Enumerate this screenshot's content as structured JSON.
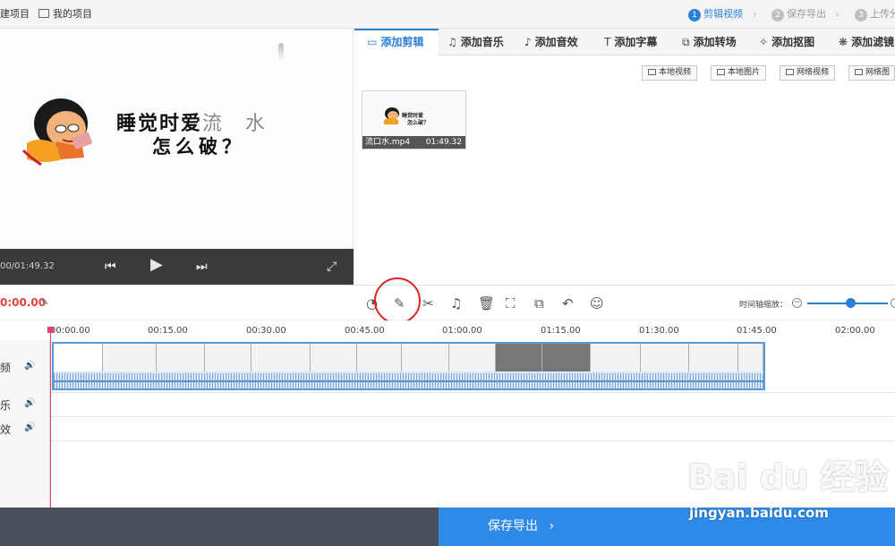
{
  "topbar": {
    "new_project": "建项目",
    "my_projects": "我的项目",
    "steps": [
      {
        "num": "1",
        "label": "剪辑视频"
      },
      {
        "num": "2",
        "label": "保存导出"
      },
      {
        "num": "3",
        "label": "上传分"
      }
    ]
  },
  "preview": {
    "title_line1_main": "睡觉时爱",
    "title_line1_faint": "流　水",
    "title_line2": "怎么破？",
    "time": "00/01:49.32"
  },
  "tabs": [
    {
      "label": "添加剪辑",
      "icon": "video-icon"
    },
    {
      "label": "添加音乐",
      "icon": "music-icon"
    },
    {
      "label": "添加音效",
      "icon": "sound-effect-icon"
    },
    {
      "label": "添加字幕",
      "icon": "text-icon"
    },
    {
      "label": "添加转场",
      "icon": "transition-icon"
    },
    {
      "label": "添加抠图",
      "icon": "cutout-icon"
    },
    {
      "label": "添加滤镜",
      "icon": "filter-icon"
    }
  ],
  "source_buttons": [
    "本地视频",
    "本地图片",
    "网络视频",
    "网络图"
  ],
  "clip": {
    "name": "流口水.mp4",
    "duration": "01:49.32",
    "thumb_text1": "睡觉时爱",
    "thumb_text2": "怎么破？"
  },
  "timeline_toolbar": {
    "current_time": "0:00.00",
    "zoom_label": "时间轴缩放：",
    "zoom_level": 0.53
  },
  "ruler_ticks": [
    "00:00.00",
    "00:15.00",
    "00:30.00",
    "00:45.00",
    "01:00.00",
    "01:15.00",
    "01:30.00",
    "01:45.00",
    "02:00.00"
  ],
  "tracks": [
    {
      "label": "频"
    },
    {
      "label": "乐"
    },
    {
      "label": "效"
    }
  ],
  "export_button": "保存导出",
  "watermark": {
    "text": "Bai du 经验",
    "url": "jingyan.baidu.com"
  }
}
